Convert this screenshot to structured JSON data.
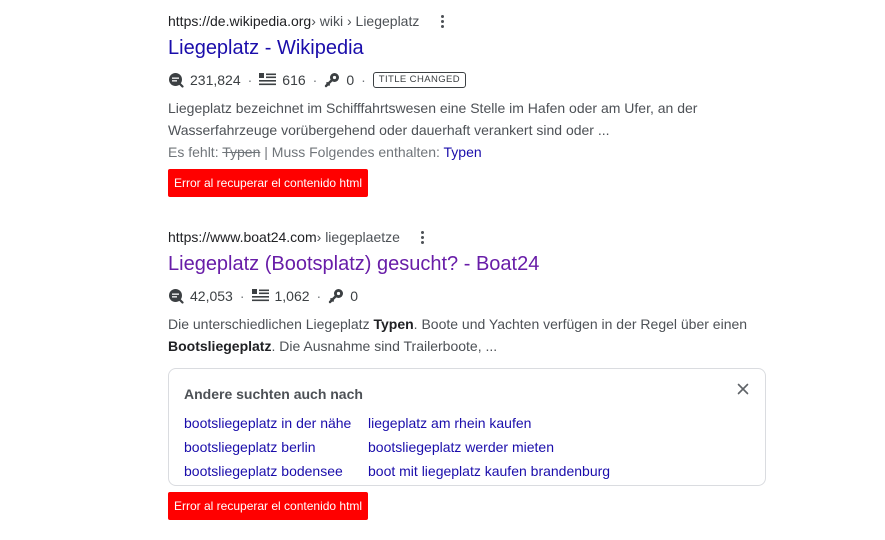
{
  "results": [
    {
      "url": "https://de.wikipedia.org",
      "breadcrumb": " › wiki › Liegeplatz",
      "title": "Liegeplatz - Wikipedia",
      "stats": {
        "views": "231,824",
        "words": "616",
        "links": "0"
      },
      "badge": "TITLE CHANGED",
      "snippet": "Liegeplatz bezeichnet im Schifffahrtswesen eine Stelle im Hafen oder am Ufer, an der Wasserfahrzeuge vorübergehend oder dauerhaft verankert sind oder ...",
      "missing": {
        "prefix": "Es fehlt: ",
        "struck": "Typen",
        "middle": " | Muss Folgendes enthalten: ",
        "link": "Typen"
      },
      "error_label": "Error al recuperar el contenido html"
    },
    {
      "url": "https://www.boat24.com",
      "breadcrumb": " › liegeplaetze",
      "title": "Liegeplatz (Bootsplatz) gesucht? - Boat24",
      "stats": {
        "views": "42,053",
        "words": "1,062",
        "links": "0"
      },
      "snippet": {
        "p1": "Die unterschiedlichen Liegeplatz ",
        "b1": "Typen",
        "p2": ". Boote und Yachten verfügen in der Regel über einen ",
        "b2": "Bootsliegeplatz",
        "p3": ". Die Ausnahme sind Trailerboote, ..."
      },
      "error_label": "Error al recuperar el contenido html"
    }
  ],
  "also_search": {
    "title": "Andere suchten auch nach",
    "items": [
      "bootsliegeplatz in der nähe",
      "liegeplatz am rhein kaufen",
      "bootsliegeplatz berlin",
      "bootsliegeplatz werder mieten",
      "bootsliegeplatz bodensee",
      "boot mit liegeplatz kaufen brandenburg"
    ]
  },
  "colors": {
    "title_link": "#1a0dab",
    "visited_title": "#681da8",
    "error_bg": "#ff0000",
    "snippet_text": "#4d5156"
  },
  "icons": [
    "views-icon",
    "words-icon",
    "links-icon",
    "more-options-icon",
    "close-icon"
  ]
}
